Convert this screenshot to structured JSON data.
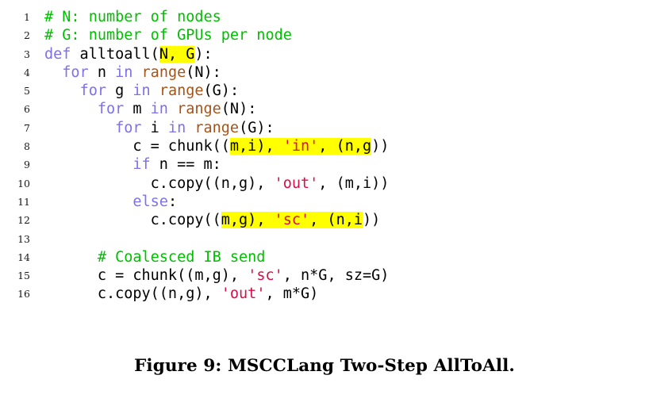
{
  "figure": {
    "caption": "Figure 9: MSCCLang Two-Step AllToAll.",
    "language": "python",
    "colors": {
      "background": "#ffffff",
      "comment": "#00bf00",
      "keyword": "#7d70ec",
      "builtin": "#a85316",
      "string": "#d90d48",
      "plain": "#000000",
      "highlight": "#ffff00",
      "lineno": "#1a1a1a"
    },
    "code": {
      "lines": [
        {
          "n": "1",
          "tokens": [
            {
              "t": "# N: number of nodes",
              "c": "comment",
              "hl": false
            }
          ]
        },
        {
          "n": "2",
          "tokens": [
            {
              "t": "# G: number of GPUs per node",
              "c": "comment",
              "hl": false
            }
          ]
        },
        {
          "n": "3",
          "tokens": [
            {
              "t": "def",
              "c": "keyword",
              "hl": false
            },
            {
              "t": " alltoall(",
              "c": "plain",
              "hl": false
            },
            {
              "t": "N, G",
              "c": "plain",
              "hl": true
            },
            {
              "t": "):",
              "c": "plain",
              "hl": false
            }
          ]
        },
        {
          "n": "4",
          "tokens": [
            {
              "t": "  ",
              "c": "plain",
              "hl": false
            },
            {
              "t": "for",
              "c": "keyword",
              "hl": false
            },
            {
              "t": " n ",
              "c": "plain",
              "hl": false
            },
            {
              "t": "in",
              "c": "keyword",
              "hl": false
            },
            {
              "t": " ",
              "c": "plain",
              "hl": false
            },
            {
              "t": "range",
              "c": "builtin",
              "hl": false
            },
            {
              "t": "(N):",
              "c": "plain",
              "hl": false
            }
          ]
        },
        {
          "n": "5",
          "tokens": [
            {
              "t": "    ",
              "c": "plain",
              "hl": false
            },
            {
              "t": "for",
              "c": "keyword",
              "hl": false
            },
            {
              "t": " g ",
              "c": "plain",
              "hl": false
            },
            {
              "t": "in",
              "c": "keyword",
              "hl": false
            },
            {
              "t": " ",
              "c": "plain",
              "hl": false
            },
            {
              "t": "range",
              "c": "builtin",
              "hl": false
            },
            {
              "t": "(G):",
              "c": "plain",
              "hl": false
            }
          ]
        },
        {
          "n": "6",
          "tokens": [
            {
              "t": "      ",
              "c": "plain",
              "hl": false
            },
            {
              "t": "for",
              "c": "keyword",
              "hl": false
            },
            {
              "t": " m ",
              "c": "plain",
              "hl": false
            },
            {
              "t": "in",
              "c": "keyword",
              "hl": false
            },
            {
              "t": " ",
              "c": "plain",
              "hl": false
            },
            {
              "t": "range",
              "c": "builtin",
              "hl": false
            },
            {
              "t": "(N):",
              "c": "plain",
              "hl": false
            }
          ]
        },
        {
          "n": "7",
          "tokens": [
            {
              "t": "        ",
              "c": "plain",
              "hl": false
            },
            {
              "t": "for",
              "c": "keyword",
              "hl": false
            },
            {
              "t": " i ",
              "c": "plain",
              "hl": false
            },
            {
              "t": "in",
              "c": "keyword",
              "hl": false
            },
            {
              "t": " ",
              "c": "plain",
              "hl": false
            },
            {
              "t": "range",
              "c": "builtin",
              "hl": false
            },
            {
              "t": "(G):",
              "c": "plain",
              "hl": false
            }
          ]
        },
        {
          "n": "8",
          "tokens": [
            {
              "t": "          c = chunk((",
              "c": "plain",
              "hl": false
            },
            {
              "t": "m,i), ",
              "c": "plain",
              "hl": true
            },
            {
              "t": "'in'",
              "c": "string",
              "hl": true
            },
            {
              "t": ", (n,g",
              "c": "plain",
              "hl": true
            },
            {
              "t": "))",
              "c": "plain",
              "hl": false
            }
          ]
        },
        {
          "n": "9",
          "tokens": [
            {
              "t": "          ",
              "c": "plain",
              "hl": false
            },
            {
              "t": "if",
              "c": "keyword",
              "hl": false
            },
            {
              "t": " n == m:",
              "c": "plain",
              "hl": false
            }
          ]
        },
        {
          "n": "10",
          "tokens": [
            {
              "t": "            c.copy((n,g), ",
              "c": "plain",
              "hl": false
            },
            {
              "t": "'out'",
              "c": "string",
              "hl": false
            },
            {
              "t": ", (m,i))",
              "c": "plain",
              "hl": false
            }
          ]
        },
        {
          "n": "11",
          "tokens": [
            {
              "t": "          ",
              "c": "plain",
              "hl": false
            },
            {
              "t": "else",
              "c": "keyword",
              "hl": false
            },
            {
              "t": ":",
              "c": "plain",
              "hl": false
            }
          ]
        },
        {
          "n": "12",
          "tokens": [
            {
              "t": "            c.copy((",
              "c": "plain",
              "hl": false
            },
            {
              "t": "m,g), ",
              "c": "plain",
              "hl": true
            },
            {
              "t": "'sc'",
              "c": "string",
              "hl": true
            },
            {
              "t": ", (n,i",
              "c": "plain",
              "hl": true
            },
            {
              "t": "))",
              "c": "plain",
              "hl": false
            }
          ]
        },
        {
          "n": "13",
          "tokens": [
            {
              "t": "",
              "c": "plain",
              "hl": false
            }
          ]
        },
        {
          "n": "14",
          "tokens": [
            {
              "t": "      ",
              "c": "plain",
              "hl": false
            },
            {
              "t": "# Coalesced IB send",
              "c": "comment",
              "hl": false
            }
          ]
        },
        {
          "n": "15",
          "tokens": [
            {
              "t": "      c = chunk((m,g), ",
              "c": "plain",
              "hl": false
            },
            {
              "t": "'sc'",
              "c": "string",
              "hl": false
            },
            {
              "t": ", n*G, sz=G)",
              "c": "plain",
              "hl": false
            }
          ]
        },
        {
          "n": "16",
          "tokens": [
            {
              "t": "      c.copy((n,g), ",
              "c": "plain",
              "hl": false
            },
            {
              "t": "'out'",
              "c": "string",
              "hl": false
            },
            {
              "t": ", m*G)",
              "c": "plain",
              "hl": false
            }
          ]
        }
      ]
    }
  }
}
